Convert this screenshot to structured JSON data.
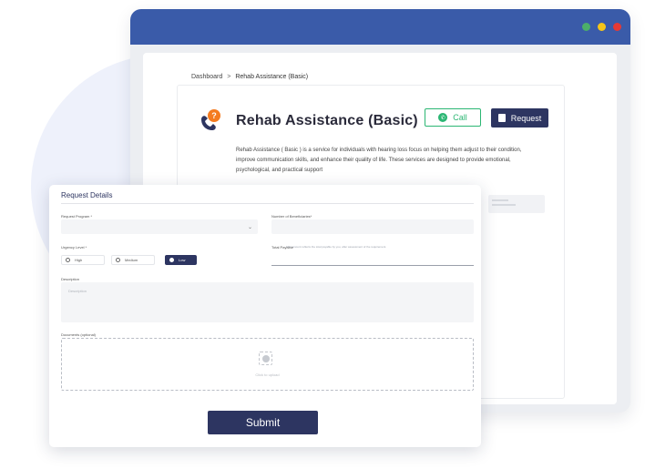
{
  "colors": {
    "brand": "#2d3561",
    "browser_bar": "#3a5ba9",
    "call_green": "#2bb673",
    "icon_orange": "#f47b20"
  },
  "breadcrumb": {
    "home": "Dashboard",
    "separator": ">",
    "current": "Rehab Assistance (Basic)"
  },
  "service": {
    "title": "Rehab Assistance (Basic)",
    "icon": "hearing-assistance-icon",
    "call_label": "Call",
    "call_icon": "phone-icon",
    "request_label": "Request",
    "request_icon": "document-icon",
    "description": "Rehab Assistance ( Basic ) is a service for individuals with hearing loss focus on helping them adjust to their condition, improve communication skills, and enhance their quality of life. These services are designed to provide emotional, psychological, and practical support"
  },
  "form": {
    "title": "Request Details",
    "request_program_label": "Request Program *",
    "request_program_value": "",
    "beneficiaries_label": "Number of Beneficiaries*",
    "beneficiaries_value": "",
    "urgency_label": "Urgency Level *",
    "urgency_options": [
      "High",
      "Medium",
      "Low"
    ],
    "urgency_selected": "Low",
    "total_payable_label": "Total Payable",
    "total_payable_note": "This amount reflects the total payable by you, after assessment of the requirement.",
    "description_label": "Description",
    "description_placeholder": "Description",
    "documents_label": "Documents (optional)",
    "upload_text": "Click to upload",
    "submit_label": "Submit"
  }
}
